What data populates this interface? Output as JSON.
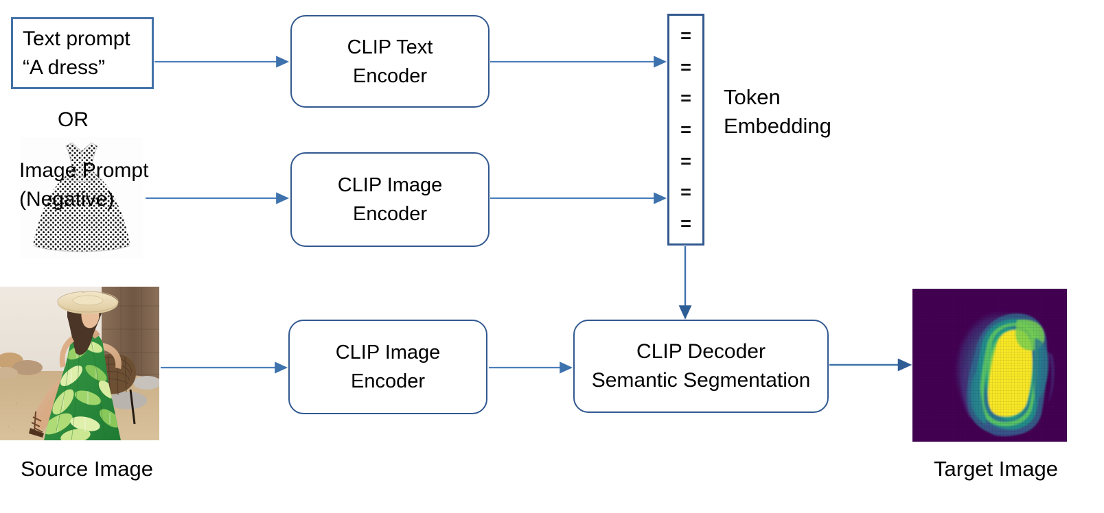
{
  "diagram": {
    "title": "CLIP-based semantic segmentation pipeline",
    "colors": {
      "box_border": "#31588f",
      "prompt_border": "#4472a8",
      "arrow": "#4a7ebb",
      "arrow_dark": "#2e5d96",
      "heatmap_background": "#440154",
      "heatmap_high": "#f7e725",
      "heatmap_mid": "#2f9e8f"
    },
    "prompt": {
      "line1": "Text prompt",
      "line2": "“A dress”"
    },
    "or_label": "OR",
    "image_prompt": {
      "line1": "Image Prompt",
      "line2": "(Negative)",
      "picture_alt": "white polka-dot sleeveless flared dress"
    },
    "boxes": {
      "text_encoder": {
        "line1": "CLIP Text",
        "line2": "Encoder"
      },
      "image_encoder_1": {
        "line1": "CLIP Image",
        "line2": "Encoder"
      },
      "image_encoder_2": {
        "line1": "CLIP Image",
        "line2": "Encoder"
      },
      "decoder": {
        "line1": "CLIP Decoder",
        "line2": "Semantic Segmentation"
      }
    },
    "token_embedding": {
      "label_line1": "Token",
      "label_line2": "Embedding",
      "rows": [
        "=",
        "=",
        "=",
        "=",
        "=",
        "=",
        "="
      ]
    },
    "captions": {
      "source": "Source Image",
      "target": "Target Image"
    },
    "source_image": {
      "alt": "woman in straw hat wearing green tropical leaf print maxi dress seated on wicker chair"
    },
    "target_image": {
      "alt": "viridis colormap segmentation heatmap of the dress region"
    }
  }
}
